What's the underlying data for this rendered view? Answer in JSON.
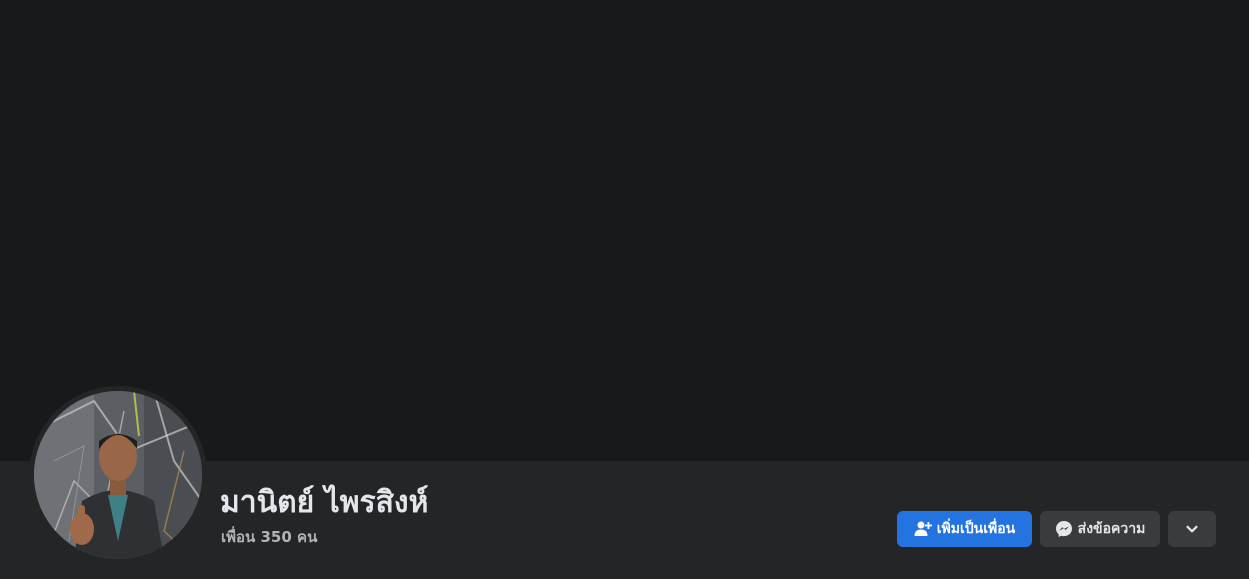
{
  "profile": {
    "name": "มานิตย์ ไพรสิงห์",
    "friends_text": "เพื่อน 350 คน"
  },
  "actions": {
    "add_friend_label": "เพิ่มเป็นเพื่อน",
    "message_label": "ส่งข้อความ",
    "add_friend_icon": "add-friend-icon",
    "message_icon": "messenger-icon",
    "more_icon": "chevron-down-icon"
  },
  "colors": {
    "background": "#18191a",
    "surface": "#242526",
    "primary_button": "#2374e1",
    "secondary_button": "#3a3b3c",
    "primary_text": "#e4e6eb",
    "secondary_text": "#b0b3b8"
  }
}
